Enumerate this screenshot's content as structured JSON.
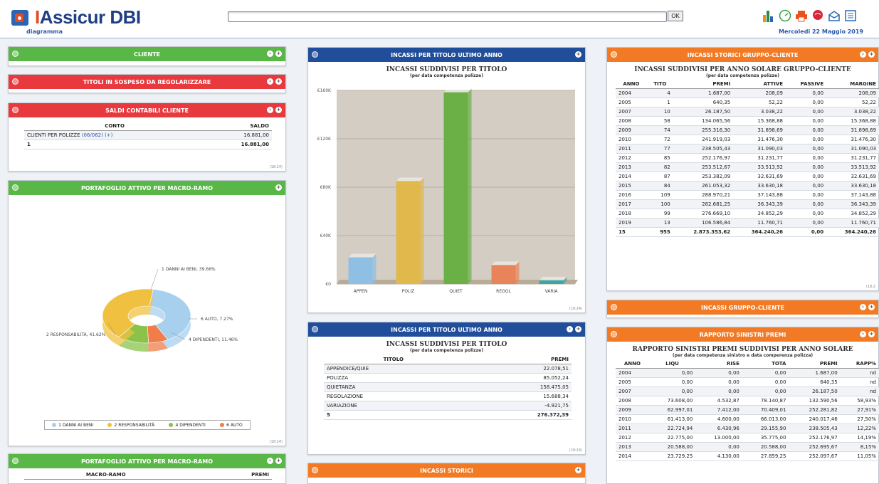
{
  "header": {
    "logo_i": "I",
    "logo_rest": "Assicur DBI",
    "sub": "diagramma",
    "ok": "OK",
    "date": "Mercoledi 22 Maggio 2019"
  },
  "icons": [
    "bar-chart-icon",
    "speedometer-icon",
    "printer-icon",
    "brain-icon",
    "mail-icon",
    "list-icon"
  ],
  "cliente": {
    "title": "CLIENTE"
  },
  "titoli": {
    "title": "TITOLI IN SOSPESO DA REGOLARIZZARE"
  },
  "saldi": {
    "title": "SALDI CONTABILI CLIENTE",
    "headers": [
      "CONTO",
      "SALDO"
    ],
    "rows": [
      [
        "CLIENTI PER POLIZZE ",
        "(06/062) (+)",
        "16.881,00"
      ]
    ],
    "total": [
      "1",
      "16.881,00"
    ],
    "time": "(18:24)"
  },
  "portafoglio": {
    "title": "PORTAFOGLIO ATTIVO PER MACRO-RAMO",
    "time": "(18:24)",
    "labels": [
      "1 DANNI AI BENI, 39.66%",
      "6 AUTO, 7.27%",
      "4 DIPENDENTI, 11.46%",
      "2 RESPONSABILITÀ, 41.62%"
    ],
    "legend": [
      "1 DANNI AI BENI",
      "2 RESPONSABILITÀ",
      "4 DIPENDENTI",
      "6 AUTO"
    ]
  },
  "portafoglio2": {
    "title": "PORTAFOGLIO ATTIVO PER MACRO-RAMO",
    "headers": [
      "MACRO-RAMO",
      "PREMI"
    ]
  },
  "incassi_chart": {
    "title": "INCASSI PER TITOLO ULTIMO ANNO",
    "chart_title": "INCASSI SUDDIVISI PER TITOLO",
    "chart_sub": "(per data competenza polizze)",
    "time": "(18:24)"
  },
  "incassi_table": {
    "title": "INCASSI PER TITOLO ULTIMO ANNO",
    "ttitle": "INCASSI SUDDIVISI PER TITOLO",
    "tsub": "(per data competenza polizze)",
    "headers": [
      "TITOLO",
      "PREMI"
    ],
    "rows": [
      [
        "APPENDICE/QUIE",
        "22.078,51"
      ],
      [
        "POLIZZA",
        "85.052,24"
      ],
      [
        "QUIETANZA",
        "158.475,05"
      ],
      [
        "REGOLAZIONE",
        "15.688,34"
      ],
      [
        "VARIAZIONE",
        "-4.921,75"
      ]
    ],
    "total": [
      "5",
      "276.372,39"
    ],
    "time": "(18:24)"
  },
  "incassi_storici": {
    "title": "INCASSI STORICI"
  },
  "storici_gruppo": {
    "title": "INCASSI STORICI GRUPPO-CLIENTE",
    "ttitle": "INCASSI SUDDIVISI PER ANNO SOLARE GRUPPO-CLIENTE",
    "tsub": "(per data competenza polizze)",
    "headers": [
      "ANNO",
      "TITO",
      "PREMI",
      "ATTIVE",
      "PASSIVE",
      "MARGINE"
    ],
    "rows": [
      [
        "2004",
        "4",
        "1.687,00",
        "208,09",
        "0,00",
        "208,09"
      ],
      [
        "2005",
        "1",
        "640,35",
        "52,22",
        "0,00",
        "52,22"
      ],
      [
        "2007",
        "10",
        "26.187,50",
        "3.038,22",
        "0,00",
        "3.038,22"
      ],
      [
        "2008",
        "58",
        "134.065,56",
        "15.368,88",
        "0,00",
        "15.368,88"
      ],
      [
        "2009",
        "74",
        "255.316,30",
        "31.898,69",
        "0,00",
        "31.898,69"
      ],
      [
        "2010",
        "72",
        "241.919,03",
        "31.476,30",
        "0,00",
        "31.476,30"
      ],
      [
        "2011",
        "77",
        "238.505,43",
        "31.090,03",
        "0,00",
        "31.090,03"
      ],
      [
        "2012",
        "85",
        "252.176,97",
        "31.231,77",
        "0,00",
        "31.231,77"
      ],
      [
        "2013",
        "82",
        "253.512,67",
        "33.513,92",
        "0,00",
        "33.513,92"
      ],
      [
        "2014",
        "87",
        "253.382,09",
        "32.631,69",
        "0,00",
        "32.631,69"
      ],
      [
        "2015",
        "84",
        "261.053,32",
        "33.630,18",
        "0,00",
        "33.630,18"
      ],
      [
        "2016",
        "109",
        "288.970,21",
        "37.143,88",
        "0,00",
        "37.143,88"
      ],
      [
        "2017",
        "100",
        "282.681,25",
        "36.343,39",
        "0,00",
        "36.343,39"
      ],
      [
        "2018",
        "99",
        "276.669,10",
        "34.852,29",
        "0,00",
        "34.852,29"
      ],
      [
        "2019",
        "13",
        "106.586,84",
        "11.760,71",
        "0,00",
        "11.760,71"
      ]
    ],
    "total": [
      "15",
      "955",
      "2.873.353,62",
      "364.240,26",
      "0,00",
      "364.240,26"
    ],
    "time": "(18:2"
  },
  "incassi_gruppo": {
    "title": "INCASSI GRUPPO-CLIENTE"
  },
  "sinistri": {
    "title": "RAPPORTO SINISTRI PREMI",
    "ttitle": "RAPPORTO SINISTRI PREMI SUDDIVISI PER ANNO SOLARE",
    "tsub": "(per data competenza sinistro e data comperenza polizza)",
    "headers": [
      "ANNO",
      "LIQU",
      "RISE",
      "TOTA",
      "PREMI",
      "RAPP%"
    ],
    "rows": [
      [
        "2004",
        "0,00",
        "0,00",
        "0,00",
        "1.687,00",
        "nd"
      ],
      [
        "2005",
        "0,00",
        "0,00",
        "0,00",
        "640,35",
        "nd"
      ],
      [
        "2007",
        "0,00",
        "0,00",
        "0,00",
        "26.187,50",
        "nd"
      ],
      [
        "2008",
        "73.608,00",
        "4.532,87",
        "78.140,87",
        "132.590,56",
        "58,93%"
      ],
      [
        "2009",
        "62.997,01",
        "7.412,00",
        "70.409,01",
        "252.281,82",
        "27,91%"
      ],
      [
        "2010",
        "61.413,00",
        "4.600,00",
        "66.013,00",
        "240.017,46",
        "27,50%"
      ],
      [
        "2011",
        "22.724,94",
        "6.430,96",
        "29.155,90",
        "238.505,43",
        "12,22%"
      ],
      [
        "2012",
        "22.775,00",
        "13.000,00",
        "35.775,00",
        "252.176,97",
        "14,19%"
      ],
      [
        "2013",
        "20.588,00",
        "0,00",
        "20.588,00",
        "252.695,67",
        "8,15%"
      ],
      [
        "2014",
        "23.729,25",
        "4.130,00",
        "27.859,25",
        "252.097,67",
        "11,05%"
      ]
    ]
  },
  "chart_data": [
    {
      "type": "bar",
      "title": "INCASSI SUDDIVISI PER TITOLO",
      "subtitle": "(per data competenza polizze)",
      "categories": [
        "APPEN",
        "POLIZ",
        "QUIET",
        "REGOL",
        "VARIA"
      ],
      "values": [
        22078.51,
        85052.24,
        158475.05,
        15688.34,
        -4921.75
      ],
      "ylim": [
        0,
        160000
      ],
      "yticks": [
        "€0",
        "€40K",
        "€80K",
        "€120K",
        "€160K"
      ],
      "colors": [
        "#8fbfe3",
        "#e0b84c",
        "#6ab047",
        "#e8845a",
        "#3aa7a7"
      ]
    },
    {
      "type": "pie",
      "categories": [
        "1 DANNI AI BENI",
        "2 RESPONSABILITÀ",
        "4 DIPENDENTI",
        "6 AUTO"
      ],
      "values": [
        39.66,
        41.62,
        11.46,
        7.27
      ],
      "colors": [
        "#a7d0ef",
        "#f0c040",
        "#8bc34a",
        "#f07d4a"
      ]
    }
  ]
}
